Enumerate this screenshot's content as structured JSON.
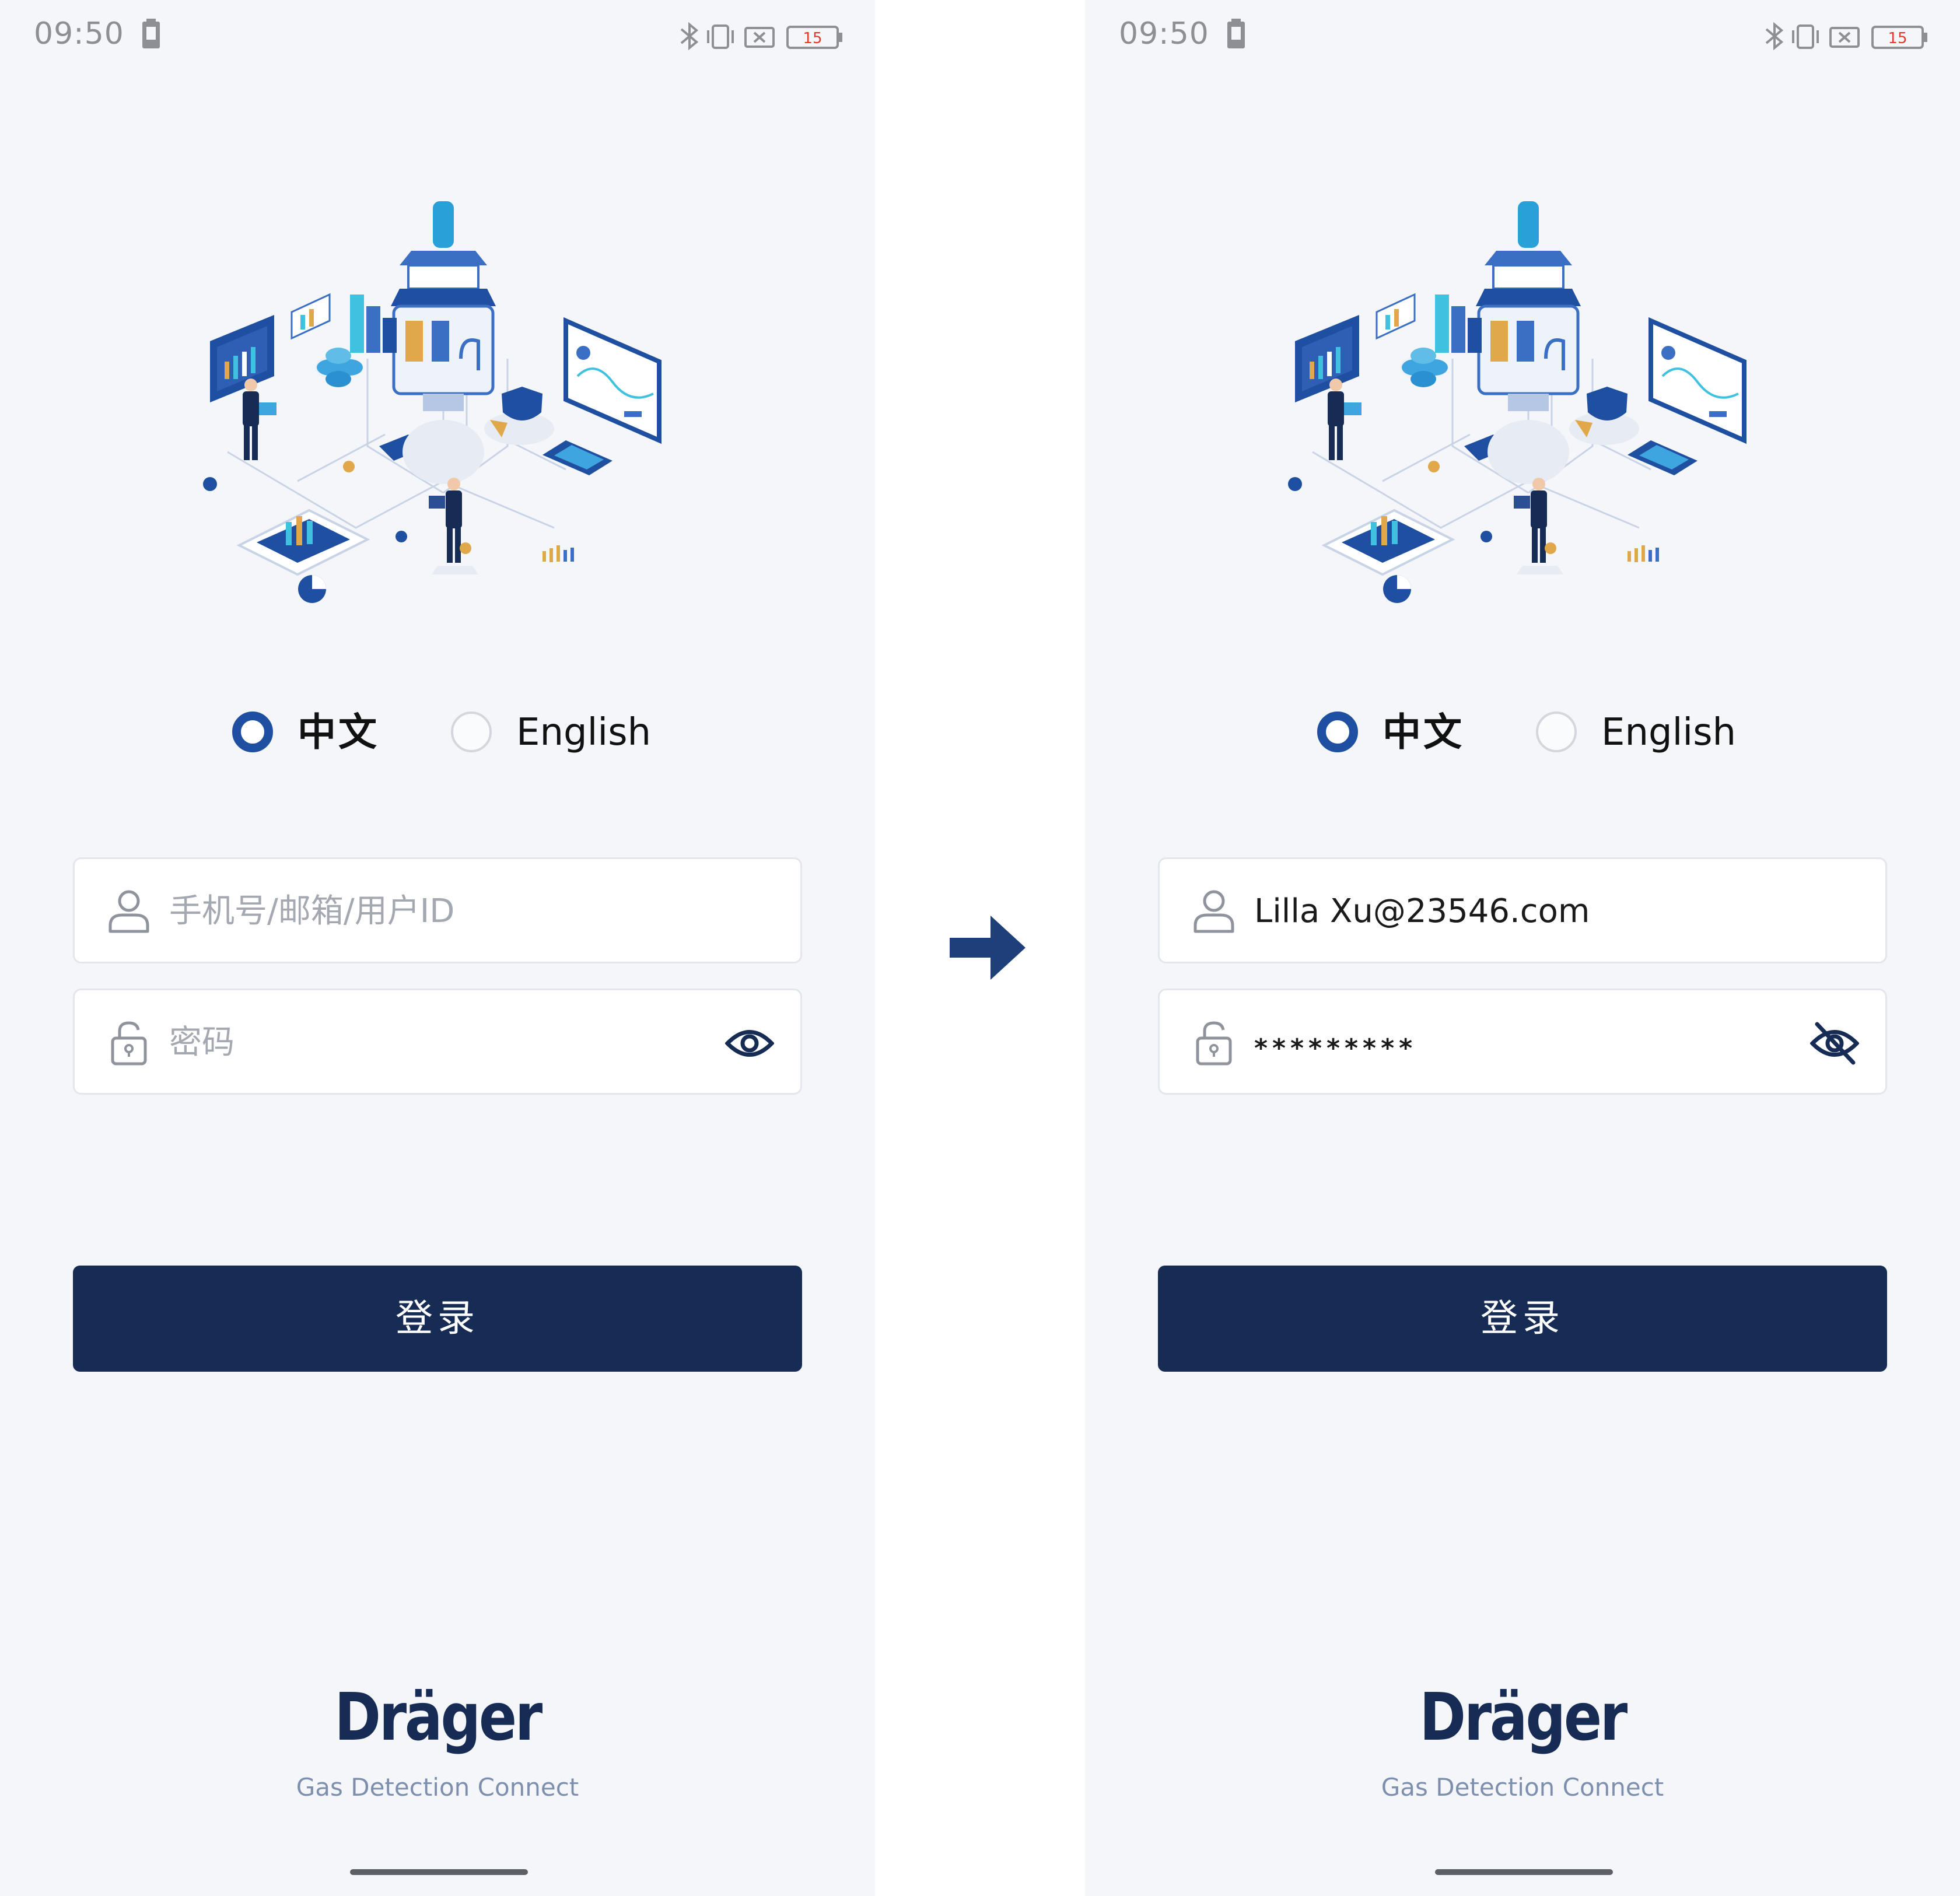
{
  "status_bar": {
    "time": "09:50",
    "battery_level": "15"
  },
  "language": {
    "options": [
      {
        "label": "中文",
        "selected": true
      },
      {
        "label": "English",
        "selected": false
      }
    ]
  },
  "screens": [
    {
      "username": {
        "placeholder": "手机号/邮箱/用户ID",
        "value": ""
      },
      "password": {
        "placeholder": "密码",
        "value": "",
        "visibility_icon": "eye-icon"
      }
    },
    {
      "username": {
        "placeholder": "手机号/邮箱/用户ID",
        "value": "Lilla Xu@23546.com"
      },
      "password": {
        "placeholder": "密码",
        "value": "*********",
        "visibility_icon": "eye-off-icon"
      }
    }
  ],
  "login_button": {
    "label": "登录"
  },
  "brand": {
    "logo_text": "Dräger",
    "tagline": "Gas Detection Connect"
  },
  "colors": {
    "primary": "#172c55",
    "accent": "#1f4fa0",
    "background": "#f4f6fa",
    "placeholder": "#a4a8b0",
    "tagline": "#7e8fae"
  }
}
